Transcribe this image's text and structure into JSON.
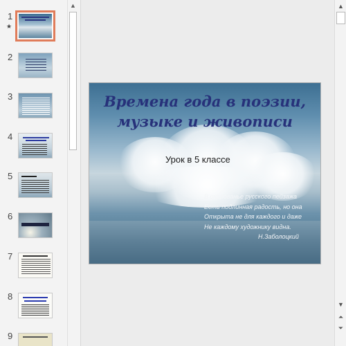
{
  "thumbnails": {
    "numbers": [
      "1",
      "2",
      "3",
      "4",
      "5",
      "6",
      "7",
      "8",
      "9"
    ],
    "active_index": 1,
    "animation_marker": "★"
  },
  "slide": {
    "title_line1": "Времена года в поэзии,",
    "title_line2": "музыке и живописи",
    "subtitle": "Урок в 5 классе",
    "poem": [
      "В очарованье русского пейзажа",
      "Есть подлинная радость, но она",
      "Открыта не для каждого и даже",
      "Не каждому художнику видна."
    ],
    "author": "Н.Заболоцкий"
  },
  "scrollbars": {
    "up_icon": "▲",
    "down_icon": "▼",
    "prev_slide_icon": "⏶",
    "next_slide_icon": "⏷"
  },
  "colors": {
    "title": "#27317a",
    "active_thumb_outline": "#e07c5a",
    "poem_text": "#f4f6f8"
  }
}
